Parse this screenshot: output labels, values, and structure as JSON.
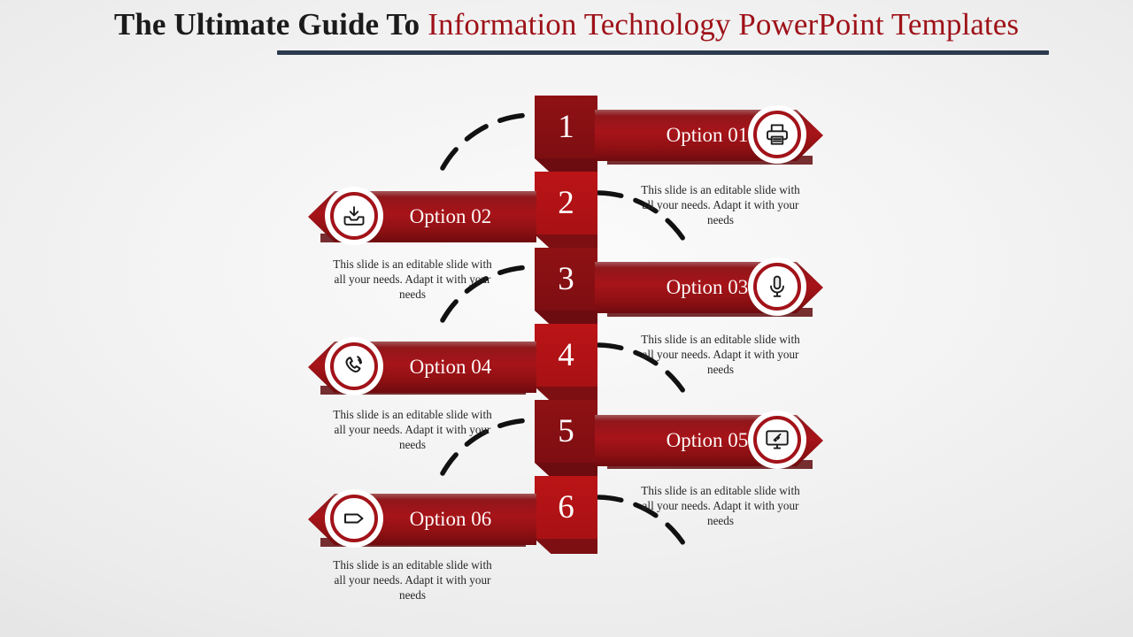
{
  "header": {
    "title_lead": "The Ultimate Guide To",
    "title_accent": "Information Technology PowerPoint Templates",
    "accent_color": "#9e1218",
    "lead_color": "#1b1b1b",
    "underline_color": "#2c3a4e"
  },
  "theme": {
    "banner_red": "#a71419",
    "banner_dark_red": "#7f1014",
    "number_dark": "#8f1114",
    "number_light": "#bb1417",
    "text_on_red": "#ffffff",
    "background": "#ececec"
  },
  "body_text": "This slide is an editable slide with all your needs. Adapt it with your needs",
  "options": [
    {
      "number": "1",
      "label": "Option 01",
      "icon": "printer-icon",
      "side": "right",
      "description": "This slide is an editable slide with all your needs. Adapt it with your needs"
    },
    {
      "number": "2",
      "label": "Option 02",
      "icon": "download-inbox-icon",
      "side": "left",
      "description": "This slide is an editable slide with all your needs. Adapt it with your needs"
    },
    {
      "number": "3",
      "label": "Option 03",
      "icon": "microphone-icon",
      "side": "right",
      "description": "This slide is an editable slide with all your needs. Adapt it with your needs"
    },
    {
      "number": "4",
      "label": "Option 04",
      "icon": "phone-call-icon",
      "side": "left",
      "description": "This slide is an editable slide with all your needs. Adapt it with your needs"
    },
    {
      "number": "5",
      "label": "Option 05",
      "icon": "desktop-monitor-icon",
      "side": "right",
      "description": "This slide is an editable slide with all your needs. Adapt it with your needs"
    },
    {
      "number": "6",
      "label": "Option 06",
      "icon": "tag-label-icon",
      "side": "left",
      "description": "This slide is an editable slide with all your needs. Adapt it with your needs"
    }
  ]
}
